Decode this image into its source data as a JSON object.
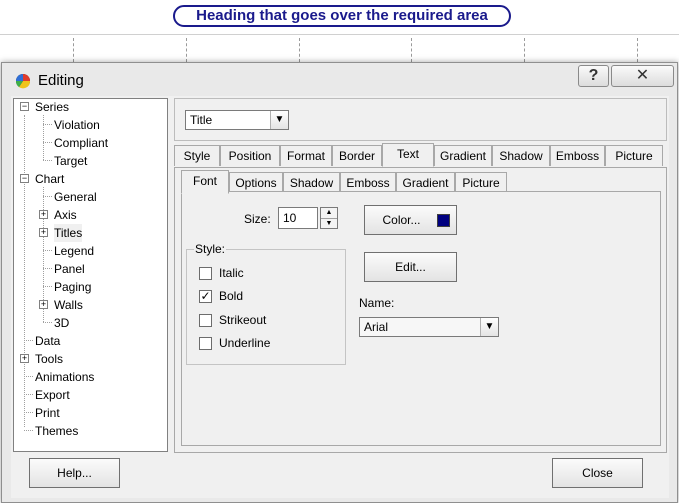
{
  "background": {
    "heading": "Heading that goes over the required area"
  },
  "window": {
    "title": "Editing",
    "help_glyph": "?",
    "close_glyph": "✕"
  },
  "tree": {
    "items": [
      {
        "label": "Series"
      },
      {
        "label": "Violation"
      },
      {
        "label": "Compliant"
      },
      {
        "label": "Target"
      },
      {
        "label": "Chart"
      },
      {
        "label": "General"
      },
      {
        "label": "Axis"
      },
      {
        "label": "Titles"
      },
      {
        "label": "Legend"
      },
      {
        "label": "Panel"
      },
      {
        "label": "Paging"
      },
      {
        "label": "Walls"
      },
      {
        "label": "3D"
      },
      {
        "label": "Data"
      },
      {
        "label": "Tools"
      },
      {
        "label": "Animations"
      },
      {
        "label": "Export"
      },
      {
        "label": "Print"
      },
      {
        "label": "Themes"
      }
    ],
    "expand_glyph": "+",
    "collapse_glyph": "−"
  },
  "title_combo": {
    "value": "Title",
    "arrow": "▼"
  },
  "tabs_top": [
    "Style",
    "Position",
    "Format",
    "Border",
    "Text",
    "Gradient",
    "Shadow",
    "Emboss",
    "Picture"
  ],
  "tabs_inner": [
    "Font",
    "Options",
    "Shadow",
    "Emboss",
    "Gradient",
    "Picture"
  ],
  "font": {
    "size_label": "Size:",
    "size_value": "10",
    "style_group": "Style:",
    "italic": {
      "label": "Italic",
      "checked": false
    },
    "bold": {
      "label": "Bold",
      "checked": true
    },
    "strikeout": {
      "label": "Strikeout",
      "checked": false
    },
    "underline": {
      "label": "Underline",
      "checked": false
    },
    "color_button": "Color...",
    "color_swatch": "#000080",
    "edit_button": "Edit...",
    "name_label": "Name:",
    "name_value": "Arial",
    "check_glyph": "✓",
    "arrow": "▼",
    "spin_up": "▲",
    "spin_down": "▼"
  },
  "footer": {
    "help_button": "Help...",
    "close_button": "Close"
  }
}
